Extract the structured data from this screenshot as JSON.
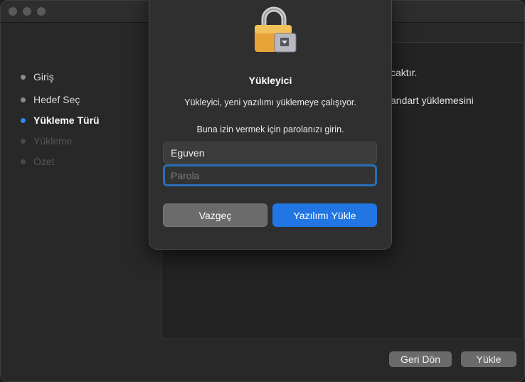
{
  "window": {
    "sidebar": {
      "items": [
        {
          "label": "Giriş",
          "state": "done"
        },
        {
          "label": "Hedef Seç",
          "state": "done"
        },
        {
          "label": "Yükleme Türü",
          "state": "active"
        },
        {
          "label": "Yükleme",
          "state": "pending"
        },
        {
          "label": "Özet",
          "state": "pending"
        }
      ]
    },
    "content": {
      "line1": "caktır.",
      "line2": "andart yüklemesini"
    },
    "buttons": {
      "back": "Geri Dön",
      "install": "Yükle"
    }
  },
  "dialog": {
    "icon": "lock-icon",
    "title": "Yükleyici",
    "message": "Yükleyici, yeni yazılımı yüklemeye çalışıyor.",
    "prompt": "Buna izin vermek için parolanızı girin.",
    "username_value": "Eguven",
    "password_placeholder": "Parola",
    "cancel_label": "Vazgeç",
    "confirm_label": "Yazılımı Yükle"
  },
  "colors": {
    "accent": "#2176e3",
    "active_dot": "#2e88f5",
    "focus_ring": "#2a6fb8"
  }
}
